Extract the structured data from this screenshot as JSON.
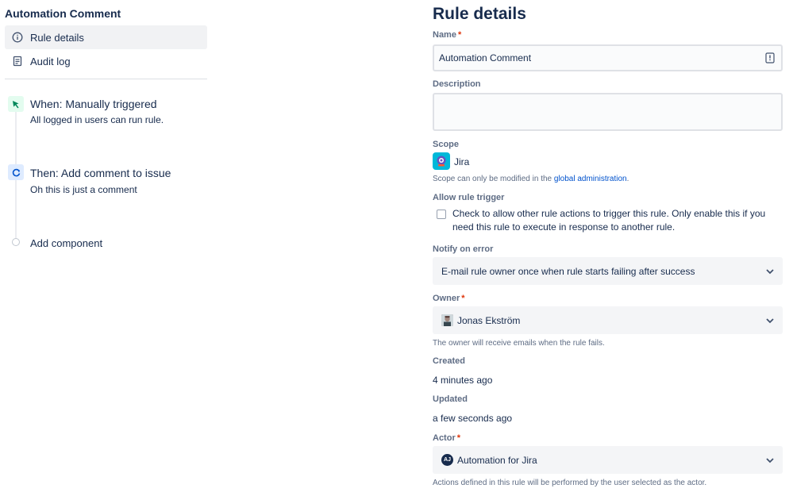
{
  "sidebar": {
    "rule_name": "Automation Comment",
    "nav": [
      {
        "label": "Rule details",
        "icon": "info-icon",
        "active": true
      },
      {
        "label": "Audit log",
        "icon": "document-icon",
        "active": false
      }
    ],
    "components": [
      {
        "title": "When: Manually triggered",
        "subtitle": "All logged in users can run rule.",
        "icon": "cursor-click-icon"
      },
      {
        "title": "Then: Add comment to issue",
        "subtitle": "Oh this is just a comment",
        "icon": "action-icon"
      }
    ],
    "add_component_label": "Add component"
  },
  "details": {
    "title": "Rule details",
    "name_label": "Name",
    "name_value": "Automation Comment",
    "description_label": "Description",
    "description_value": "",
    "scope_label": "Scope",
    "scope_value": "Jira",
    "scope_hint_prefix": "Scope can only be modified in the ",
    "scope_hint_link": "global administration",
    "scope_hint_suffix": ".",
    "allow_trigger_label": "Allow rule trigger",
    "allow_trigger_text": "Check to allow other rule actions to trigger this rule. Only enable this if you need this rule to execute in response to another rule.",
    "allow_trigger_checked": false,
    "notify_label": "Notify on error",
    "notify_value": "E-mail rule owner once when rule starts failing after success",
    "owner_label": "Owner",
    "owner_value": "Jonas Ekström",
    "owner_hint": "The owner will receive emails when the rule fails.",
    "created_label": "Created",
    "created_value": "4 minutes ago",
    "updated_label": "Updated",
    "updated_value": "a few seconds ago",
    "actor_label": "Actor",
    "actor_avatar_text": "AJ",
    "actor_value": "Automation for Jira",
    "actor_hint": "Actions defined in this rule will be performed by the user selected as the actor.",
    "required_mark": "*"
  },
  "colors": {
    "trigger_icon_bg": "#e3fcef",
    "trigger_icon_fg": "#00875a",
    "action_icon_bg": "#deebff",
    "action_icon_fg": "#0052cc",
    "link": "#0052cc",
    "required": "#de350b"
  }
}
